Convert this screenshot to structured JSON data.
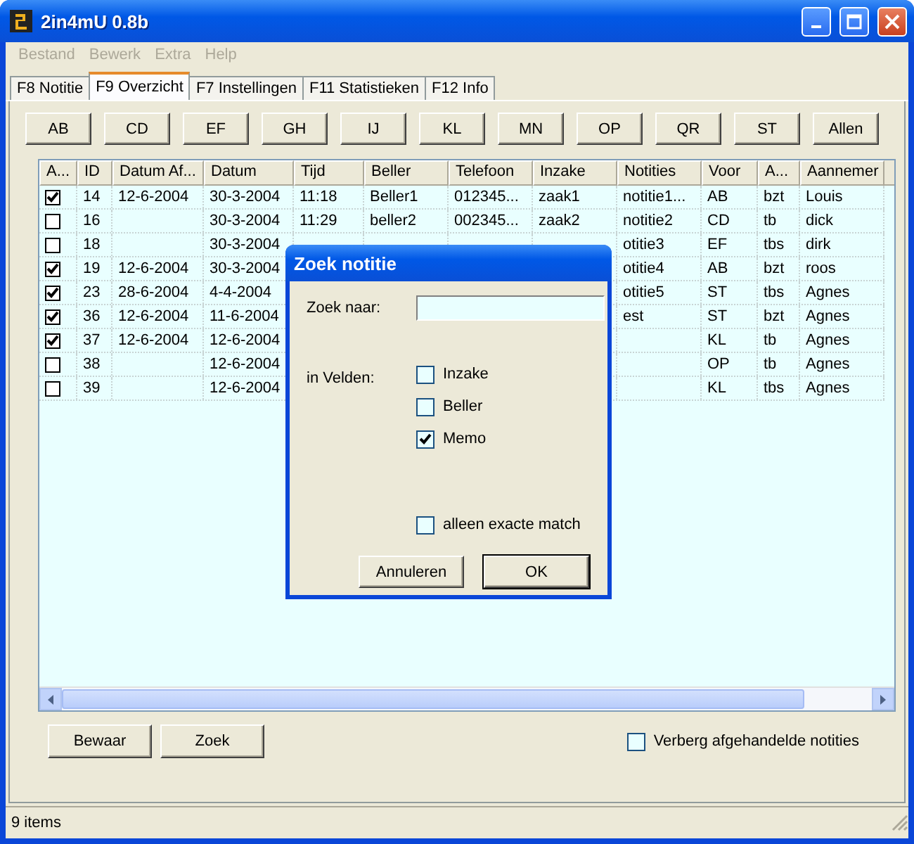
{
  "window": {
    "title": "2in4mU 0.8b"
  },
  "menu": [
    {
      "label": "Bestand",
      "disabled": true
    },
    {
      "label": "Bewerk",
      "disabled": true
    },
    {
      "label": "Extra",
      "disabled": true
    },
    {
      "label": "Help",
      "disabled": true
    }
  ],
  "tabs": [
    {
      "label": "F8  Notitie",
      "selected": false
    },
    {
      "label": "F9  Overzicht",
      "selected": true
    },
    {
      "label": "F7  Instellingen",
      "selected": false
    },
    {
      "label": "F11  Statistieken",
      "selected": false
    },
    {
      "label": "F12  Info",
      "selected": false
    }
  ],
  "letter_buttons": [
    "AB",
    "CD",
    "EF",
    "GH",
    "IJ",
    "KL",
    "MN",
    "OP",
    "QR",
    "ST",
    "Allen"
  ],
  "table": {
    "columns": [
      "A...",
      "ID",
      "Datum Af...",
      "Datum",
      "Tijd",
      "Beller",
      "Telefoon",
      "Inzake",
      "Notities",
      "Voor",
      "A...",
      "Aannemer"
    ],
    "rows": [
      {
        "checked": true,
        "id": "14",
        "datum_af": "12-6-2004",
        "datum": "30-3-2004",
        "tijd": "11:18",
        "beller": "Beller1",
        "telefoon": "012345...",
        "inzake": "zaak1",
        "notities": "notitie1...",
        "voor": "AB",
        "column_11": "bzt",
        "aannemer": "Louis"
      },
      {
        "checked": false,
        "id": "16",
        "datum": "30-3-2004",
        "tijd": "11:29",
        "beller": "beller2",
        "telefoon": "002345...",
        "inzake": "zaak2",
        "notities": "notitie2",
        "voor": "CD",
        "column_11": "tb",
        "aannemer": "dick"
      },
      {
        "checked": false,
        "id": "18",
        "datum": "30-3-2004",
        "notities": "otitie3",
        "voor": "EF",
        "column_11": "tbs",
        "aannemer": "dirk"
      },
      {
        "checked": true,
        "id": "19",
        "datum_af": "12-6-2004",
        "datum": "30-3-2004",
        "notities": "otitie4",
        "voor": "AB",
        "column_11": "bzt",
        "aannemer": "roos"
      },
      {
        "checked": true,
        "id": "23",
        "datum_af": "28-6-2004",
        "datum": "4-4-2004",
        "notities": "otitie5",
        "voor": "ST",
        "column_11": "tbs",
        "aannemer": "Agnes"
      },
      {
        "checked": true,
        "id": "36",
        "datum_af": "12-6-2004",
        "datum": "11-6-2004",
        "notities": "est",
        "voor": "ST",
        "column_11": "bzt",
        "aannemer": "Agnes"
      },
      {
        "checked": true,
        "id": "37",
        "datum_af": "12-6-2004",
        "datum": "12-6-2004",
        "voor": "KL",
        "column_11": "tb",
        "aannemer": "Agnes"
      },
      {
        "checked": false,
        "id": "38",
        "datum": "12-6-2004",
        "voor": "OP",
        "column_11": "tb",
        "aannemer": "Agnes"
      },
      {
        "checked": false,
        "id": "39",
        "datum": "12-6-2004",
        "voor": "KL",
        "column_11": "tbs",
        "aannemer": "Agnes"
      }
    ]
  },
  "footer": {
    "buttons": [
      "Bewaar",
      "Zoek"
    ],
    "hide_done": {
      "label": "Verberg afgehandelde notities",
      "checked": false
    }
  },
  "status_bar": "9 items",
  "dialog": {
    "title": "Zoek notitie",
    "search_label": "Zoek naar:",
    "fields_label": "in Velden:",
    "fields": [
      {
        "label": "Inzake",
        "checked": false
      },
      {
        "label": "Beller",
        "checked": false
      },
      {
        "label": "Memo",
        "checked": true
      }
    ],
    "exact_match": {
      "label": "alleen exacte match",
      "checked": false
    },
    "buttons": [
      {
        "label": "Annuleren",
        "default": false
      },
      {
        "label": "OK",
        "default": true
      }
    ]
  }
}
